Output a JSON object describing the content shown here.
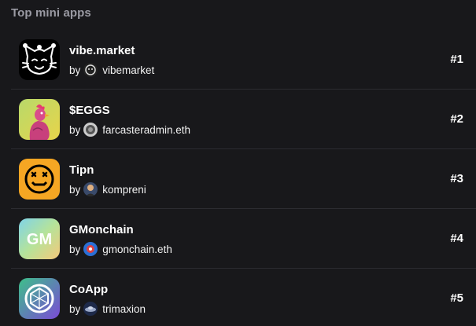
{
  "section": {
    "title": "Top mini apps",
    "by_label": "by"
  },
  "apps": [
    {
      "name": "vibe.market",
      "author": "vibemarket",
      "rank": "#1",
      "icon": "jester-cat-icon",
      "avatar": "vibemarket-avatar"
    },
    {
      "name": "$EGGS",
      "author": "farcasteradmin.eth",
      "rank": "#2",
      "icon": "rooster-icon",
      "avatar": "farcasteradmin-avatar"
    },
    {
      "name": "Tipn",
      "author": "kompreni",
      "rank": "#3",
      "icon": "smiley-face-icon",
      "avatar": "kompreni-avatar"
    },
    {
      "name": "GMonchain",
      "author": "gmonchain.eth",
      "rank": "#4",
      "icon": "gm-logo-icon",
      "avatar": "gmonchain-avatar"
    },
    {
      "name": "CoApp",
      "author": "trimaxion",
      "rank": "#5",
      "icon": "coapp-logo-icon",
      "avatar": "trimaxion-avatar"
    }
  ],
  "colors": {
    "background": "#18181b",
    "heading": "#9a9aa3",
    "divider": "#2c2c31",
    "text": "#ffffff"
  }
}
